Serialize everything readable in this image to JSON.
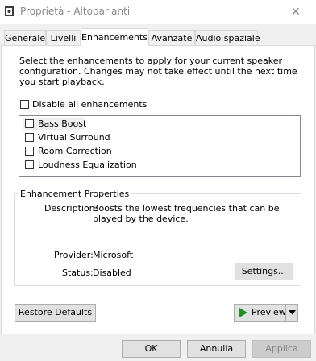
{
  "window": {
    "title": "Proprietà - Altoparlanti",
    "close_glyph": "✕"
  },
  "tabs": [
    {
      "label": "Generale"
    },
    {
      "label": "Livelli"
    },
    {
      "label": "Enhancements",
      "active": true
    },
    {
      "label": "Avanzate"
    },
    {
      "label": "Audio spaziale"
    }
  ],
  "panel": {
    "description": "Select the enhancements to apply for your current speaker configuration. Changes may not take effect until the next time you start playback.",
    "disable_all": {
      "label": "Disable all enhancements",
      "checked": false
    },
    "enhancements": [
      {
        "label": "Bass Boost",
        "checked": false,
        "selected": true
      },
      {
        "label": "Virtual Surround",
        "checked": false
      },
      {
        "label": "Room Correction",
        "checked": false
      },
      {
        "label": "Loudness Equalization",
        "checked": false
      }
    ],
    "properties": {
      "title": "Enhancement Properties",
      "description_label": "Description:",
      "description_value": "Boosts the lowest frequencies that can be played by the device.",
      "provider_label": "Provider:",
      "provider_value": "Microsoft",
      "status_label": "Status:",
      "status_value": "Disabled",
      "settings_button": "Settings..."
    },
    "restore_defaults": "Restore Defaults",
    "preview_button": "Preview"
  },
  "footer": {
    "ok": "OK",
    "cancel": "Annulla",
    "apply": "Applica"
  },
  "colors": {
    "play_icon": "#1f8f1f",
    "window_bg": "#f0f0f0",
    "panel_bg": "#ffffff"
  }
}
